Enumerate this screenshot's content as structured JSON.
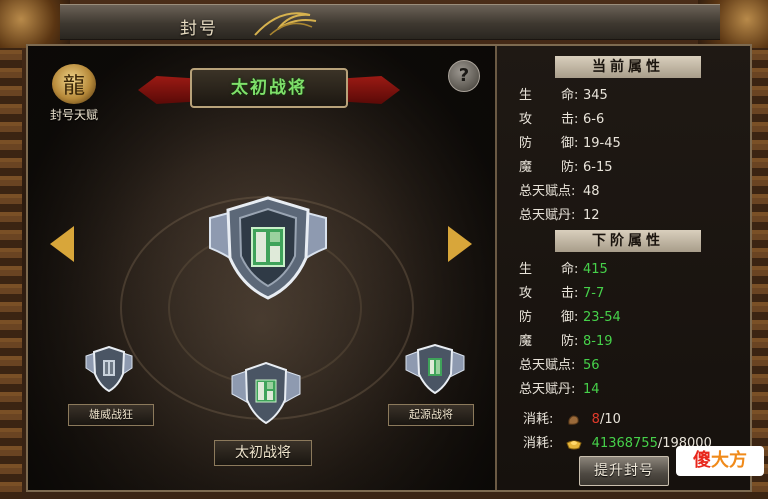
{
  "window": {
    "title": "封号"
  },
  "talent": {
    "label": "封号天赋"
  },
  "help": {
    "label": "?"
  },
  "banner": {
    "title": "太初战将"
  },
  "ranks": {
    "left": {
      "label": "雄威战狂"
    },
    "center": {
      "label": "太初战将"
    },
    "right": {
      "label": "起源战将"
    }
  },
  "current_attrs": {
    "heading": "当前属性",
    "rows": [
      {
        "k1": "生",
        "k2": "命:",
        "value": "345"
      },
      {
        "k1": "攻",
        "k2": "击:",
        "value": "6-6"
      },
      {
        "k1": "防",
        "k2": "御:",
        "value": "19-45"
      },
      {
        "k1": "魔",
        "k2": "防:",
        "value": "6-15"
      },
      {
        "label": "总天赋点:",
        "value": "48"
      },
      {
        "label": "总天赋丹:",
        "value": "12"
      }
    ]
  },
  "next_attrs": {
    "heading": "下阶属性",
    "rows": [
      {
        "k1": "生",
        "k2": "命:",
        "value": "415"
      },
      {
        "k1": "攻",
        "k2": "击:",
        "value": "7-7"
      },
      {
        "k1": "防",
        "k2": "御:",
        "value": "23-54"
      },
      {
        "k1": "魔",
        "k2": "防:",
        "value": "8-19"
      },
      {
        "label": "总天赋点:",
        "value": "56"
      },
      {
        "label": "总天赋丹:",
        "value": "14"
      }
    ]
  },
  "costs": [
    {
      "label": "消耗:",
      "current": "8",
      "total": "/10",
      "icon": "token-icon"
    },
    {
      "label": "消耗:",
      "current": "41368755",
      "total": "/198000",
      "icon": "gold-ingot-icon"
    }
  ],
  "upgrade": {
    "label": "提升封号"
  },
  "watermark": {
    "part_a": "傻",
    "part_b": "大方"
  },
  "colors": {
    "accent_green": "#46d14a",
    "cost_red": "#e03a2a",
    "gold": "#d8a63a"
  }
}
